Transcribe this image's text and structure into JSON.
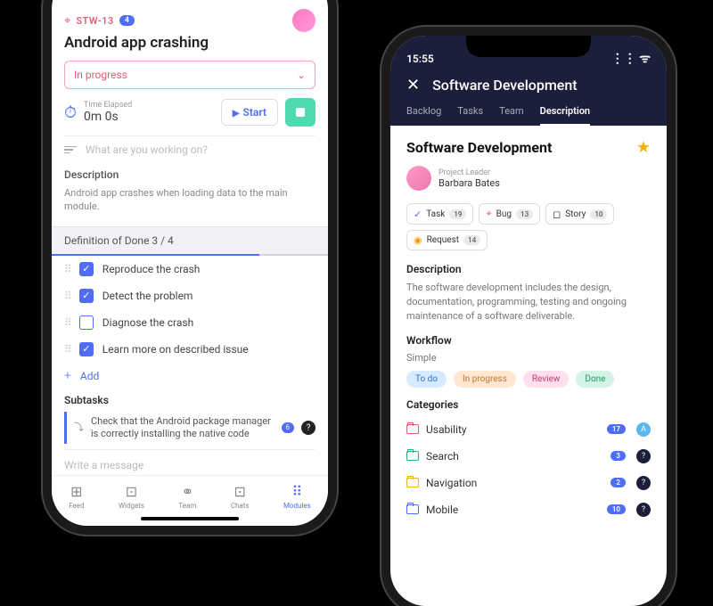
{
  "left": {
    "ticket": {
      "id": "STW-13",
      "badge": "4",
      "title": "Android app crashing"
    },
    "status": {
      "label": "In progress"
    },
    "timer": {
      "label": "Time Elapsed",
      "value": "0m 0s",
      "start": "Start"
    },
    "working_placeholder": "What are you working on?",
    "description": {
      "heading": "Description",
      "text": "Android app crashes when loading data to the main module."
    },
    "dod": {
      "heading": "Definition of Done 3 / 4",
      "items": [
        {
          "label": "Reproduce the crash",
          "checked": true
        },
        {
          "label": "Detect the problem",
          "checked": true
        },
        {
          "label": "Diagnose the crash",
          "checked": false
        },
        {
          "label": "Learn more on described issue",
          "checked": true
        }
      ],
      "add": "Add"
    },
    "subtasks": {
      "heading": "Subtasks",
      "item": {
        "text": "Check that the Android package manager is correctly installing the native code",
        "badge": "6"
      }
    },
    "message_placeholder": "Write a message",
    "tabs": [
      "Feed",
      "Widgets",
      "Team",
      "Chats",
      "Modules"
    ],
    "active_tab": 4
  },
  "right": {
    "clock": "15:55",
    "title": "Software Development",
    "nav_tabs": [
      "Backlog",
      "Tasks",
      "Team",
      "Description"
    ],
    "active_nav": 3,
    "page_title": "Software Development",
    "leader": {
      "role": "Project Leader",
      "name": "Barbara Bates"
    },
    "types": [
      {
        "icon": "✓",
        "color": "#4f6df5",
        "label": "Task",
        "count": "19"
      },
      {
        "icon": "⌖",
        "color": "#e85d75",
        "label": "Bug",
        "count": "13"
      },
      {
        "icon": "◻",
        "color": "#222",
        "label": "Story",
        "count": "10"
      },
      {
        "icon": "◉",
        "color": "#f59e0b",
        "label": "Request",
        "count": "14"
      }
    ],
    "description": {
      "heading": "Description",
      "text": "The software development includes the design, documentation, programming, testing and ongoing maintenance of a software deliverable."
    },
    "workflow": {
      "heading": "Workflow",
      "label": "Simple",
      "states": [
        "To do",
        "In progress",
        "Review",
        "Done"
      ]
    },
    "categories": {
      "heading": "Categories",
      "items": [
        {
          "label": "Usability",
          "color": "#e85d75",
          "count": "17",
          "extra": "blue"
        },
        {
          "label": "Search",
          "color": "#22b37a",
          "count": "3",
          "extra": "dark"
        },
        {
          "label": "Navigation",
          "color": "#f5b301",
          "count": "2",
          "extra": "dark"
        },
        {
          "label": "Mobile",
          "color": "#4f6df5",
          "count": "10",
          "extra": "dark"
        }
      ]
    }
  }
}
